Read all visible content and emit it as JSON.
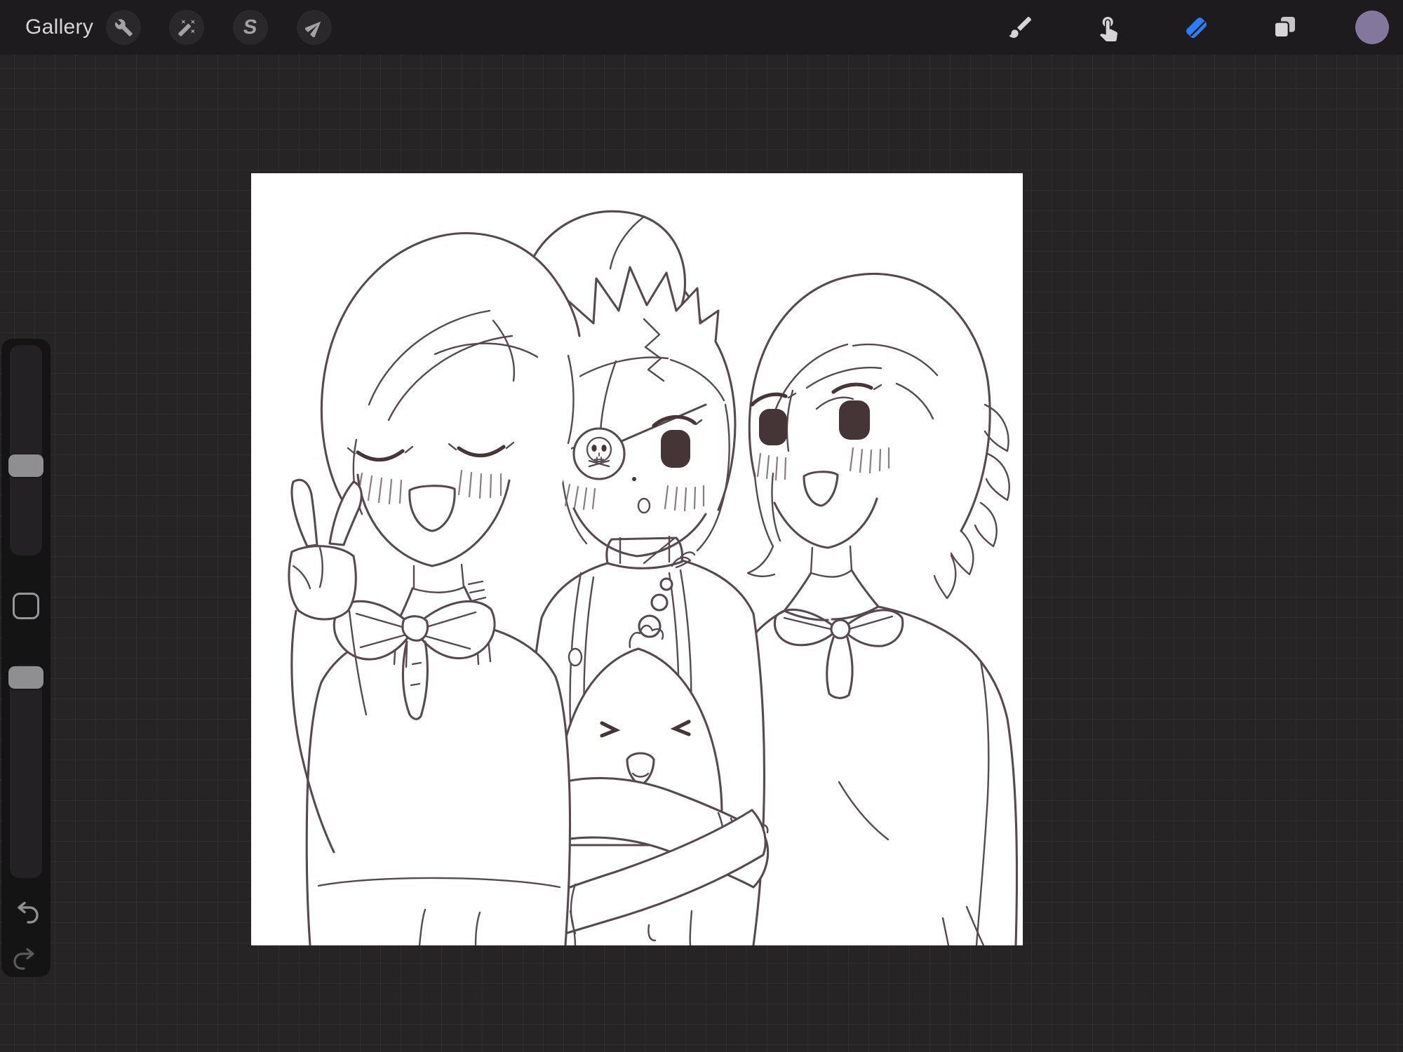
{
  "top_bar": {
    "gallery_label": "Gallery",
    "selection_glyph": "S",
    "left_tools": [
      {
        "id": "actions",
        "icon": "wrench-icon"
      },
      {
        "id": "adjustments",
        "icon": "magic-wand-icon"
      },
      {
        "id": "selection",
        "icon": "s-ribbon-icon"
      },
      {
        "id": "transform",
        "icon": "arrow-cursor-icon"
      }
    ],
    "right_tools": [
      {
        "id": "paint",
        "icon": "brush-icon",
        "active": false
      },
      {
        "id": "smudge",
        "icon": "finger-icon",
        "active": false
      },
      {
        "id": "erase",
        "icon": "eraser-icon",
        "active": true
      },
      {
        "id": "layers",
        "icon": "layers-icon",
        "active": false
      },
      {
        "id": "color",
        "icon": "color-swatch",
        "active": false
      }
    ]
  },
  "sidebar": {
    "sliders": [
      {
        "name": "brush-size",
        "fraction": 0.55
      },
      {
        "name": "opacity",
        "fraction": 0.02
      }
    ],
    "has_modify_button": true,
    "undo_visible": true,
    "redo_visible": true
  },
  "canvas": {
    "subject": "Hand-drawn line art of three anime school characters: left girl with side ponytail, closed happy eyes and peace sign; middle character with spiky hair, skull eyepatch and high-collar jacket hugging a chick plush with crossed arms; right girl with fluffy flipped bob, big eyes and ribbon bow."
  },
  "colors": {
    "top_bar_bg": "#1d1b1d",
    "workspace_bg": "#272425",
    "grid_line": "#312e2f",
    "button_circle_bg": "#2a282b",
    "icon_gray": "#a5a2a5",
    "icon_light": "#d6d4d6",
    "icon_light_back": "#c6c4c6",
    "eraser_active_blue": "#2e7cf6",
    "color_swatch_purple": "#84779e",
    "sidebar_bg": "#151415",
    "slider_track": "#232124",
    "slider_handle": "#8f8e90",
    "undo_arrow": "#8f8e90",
    "redo_arrow": "#5a595c",
    "canvas_bg": "#ffffff",
    "line_art": "#584850",
    "eye_fill": "#463536"
  }
}
